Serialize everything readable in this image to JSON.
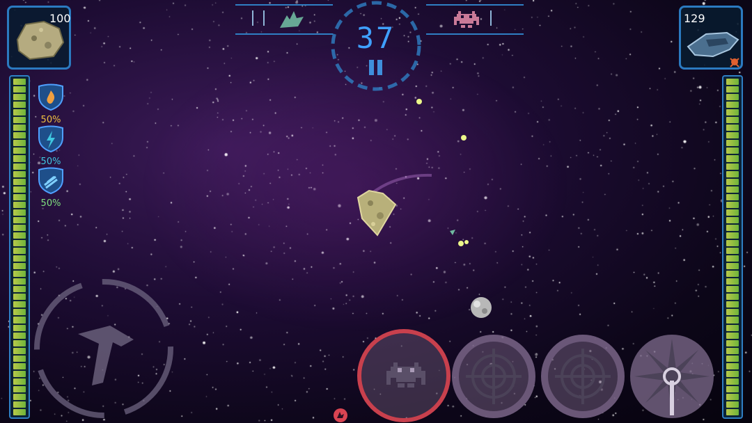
{
  "player": {
    "hp": "100",
    "avatar_icon": "asteroid-ship-icon"
  },
  "enemy": {
    "hp": "129",
    "avatar_icon": "alien-ship-icon",
    "status_icon": "skull-icon"
  },
  "resists": [
    {
      "type": "fire",
      "icon": "fire-shield-icon",
      "value": "50%",
      "color": "#f0c040"
    },
    {
      "type": "lightning",
      "icon": "lightning-shield-icon",
      "value": "50%",
      "color": "#3fc7e0"
    },
    {
      "type": "kinetic",
      "icon": "kinetic-shield-icon",
      "value": "50%",
      "color": "#7fe07f"
    }
  ],
  "timer": {
    "value": "37"
  },
  "top_bar": {
    "left_icon": "alien-fleet-icon",
    "right_icon": "space-invader-icon"
  },
  "controls": {
    "joystick_icon": "ship-icon",
    "buttons": [
      {
        "name": "special-attack",
        "icon": "space-invader-icon",
        "active": true
      },
      {
        "name": "fire-primary",
        "icon": "crosshair-icon"
      },
      {
        "name": "fire-secondary",
        "icon": "crosshair-icon"
      },
      {
        "name": "burst",
        "icon": "starburst-icon"
      }
    ]
  },
  "energy": {
    "player_level": 1.0,
    "enemy_level": 1.0
  },
  "colors": {
    "accent": "#2f7fc4",
    "timer": "#3fa0ff",
    "energy": "#a9c44a",
    "active_ring": "#d94452"
  }
}
